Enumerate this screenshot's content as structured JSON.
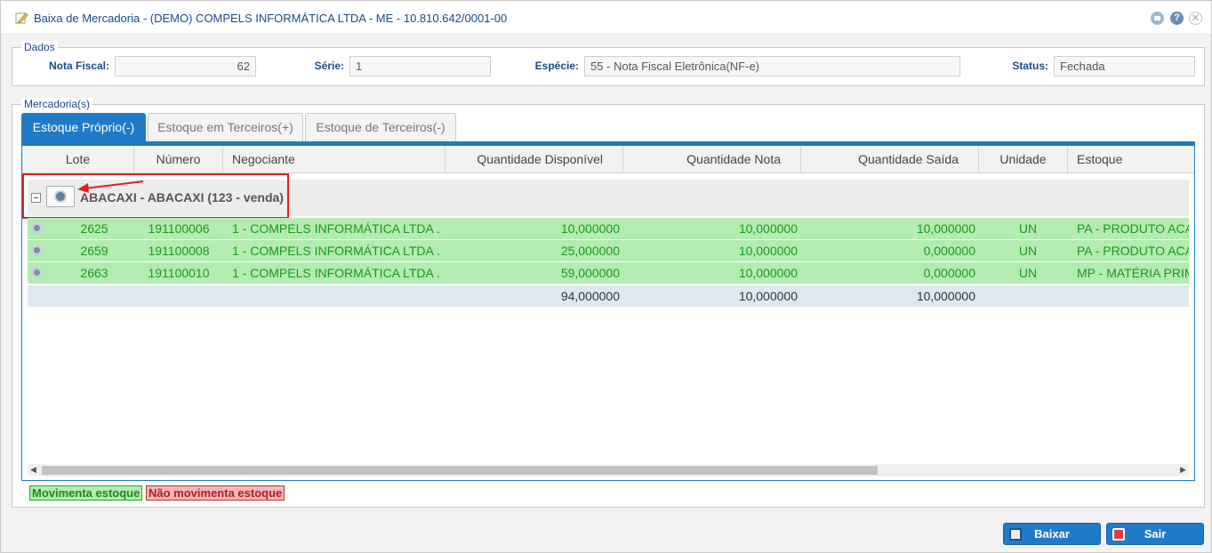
{
  "window": {
    "title": "Baixa de Mercadoria - (DEMO) COMPELS INFORMÁTICA LTDA - ME - 10.810.642/0001-00"
  },
  "dados": {
    "legend": "Dados",
    "nota_label": "Nota Fiscal:",
    "nota_value": "62",
    "serie_label": "Série:",
    "serie_value": "1",
    "especie_label": "Espécie:",
    "especie_value": "55 - Nota Fiscal Eletrônica(NF-e)",
    "status_label": "Status:",
    "status_value": "Fechada"
  },
  "mercadorias": {
    "legend": "Mercadoria(s)",
    "tabs": [
      {
        "label": "Estoque Próprio(-)"
      },
      {
        "label": "Estoque em Terceiros(+)"
      },
      {
        "label": "Estoque de Terceiros(-)"
      }
    ],
    "columns": [
      "Lote",
      "Número",
      "Negociante",
      "Quantidade Disponível",
      "Quantidade Nota",
      "Quantidade Saída",
      "Unidade",
      "Estoque"
    ],
    "group_label": "ABACAXI - ABACAXI  (123 - venda)",
    "rows": [
      {
        "lote": "2625",
        "numero": "191100006",
        "negociante": "1 - COMPELS INFORMÁTICA LTDA ...",
        "disponivel": "10,000000",
        "nota": "10,000000",
        "saida": "10,000000",
        "unidade": "UN",
        "estoque": "PA - PRODUTO ACABADO"
      },
      {
        "lote": "2659",
        "numero": "191100008",
        "negociante": "1 - COMPELS INFORMÁTICA LTDA ...",
        "disponivel": "25,000000",
        "nota": "10,000000",
        "saida": "0,000000",
        "unidade": "UN",
        "estoque": "PA - PRODUTO ACABADO"
      },
      {
        "lote": "2663",
        "numero": "191100010",
        "negociante": "1 - COMPELS INFORMÁTICA LTDA ...",
        "disponivel": "59,000000",
        "nota": "10,000000",
        "saida": "0,000000",
        "unidade": "UN",
        "estoque": "MP - MATÉRIA PRIMA"
      }
    ],
    "totals": {
      "disponivel": "94,000000",
      "nota": "10,000000",
      "saida": "10,000000"
    }
  },
  "legend_items": {
    "movimenta": "Movimenta estoque",
    "nao_movimenta": "Não movimenta estoque"
  },
  "buttons": {
    "baixar": "Baixar",
    "sair": "Sair"
  }
}
